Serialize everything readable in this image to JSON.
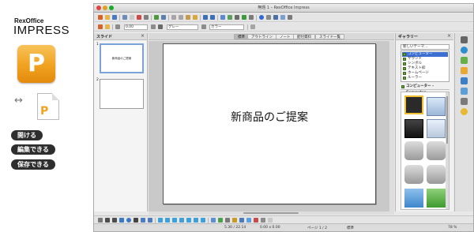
{
  "brand": {
    "subtitle": "RexOffice",
    "title": "IMPRESS",
    "app_icon_letter": "P",
    "arrows": "↔",
    "doc_icon_letter": "P"
  },
  "features": [
    "開ける",
    "編集できる",
    "保存できる"
  ],
  "window": {
    "title": "無題 1 – RexOffice Impress",
    "toolbar": {
      "zoom_field": "0.00",
      "fill_field": "グレー",
      "line_field": "カラー"
    },
    "slides_pane": {
      "label": "スライド",
      "close": "×",
      "slides": [
        {
          "number": "1",
          "title": "新商品のご提案",
          "selected": true
        },
        {
          "number": "2",
          "title": "",
          "selected": false
        }
      ]
    },
    "view_tabs": [
      "標準",
      "アウトライン",
      "ノート",
      "配付資料",
      "スライド一覧"
    ],
    "active_tab": "標準",
    "slide": {
      "title": "新商品のご提案"
    },
    "gallery": {
      "label": "ギャラリー",
      "close": "×",
      "new_theme": "新しいテーマ...",
      "themes": [
        "コンピューター",
        "サウンド",
        "シンボル",
        "テキスト枠",
        "ホームページ",
        "ルーラー"
      ],
      "selected_theme": "コンピューター",
      "current_theme": "コンピューター - Computer"
    },
    "status": {
      "position": "5.30 / 22.14",
      "size": "0.00 x 0.00",
      "page": "ページ 1 / 2",
      "layout": "標準",
      "zoom": "78 %"
    },
    "colors": {
      "accent": "#f0a21f",
      "selection": "#3c6fd1",
      "theme_green": "#6a9c3a"
    }
  }
}
